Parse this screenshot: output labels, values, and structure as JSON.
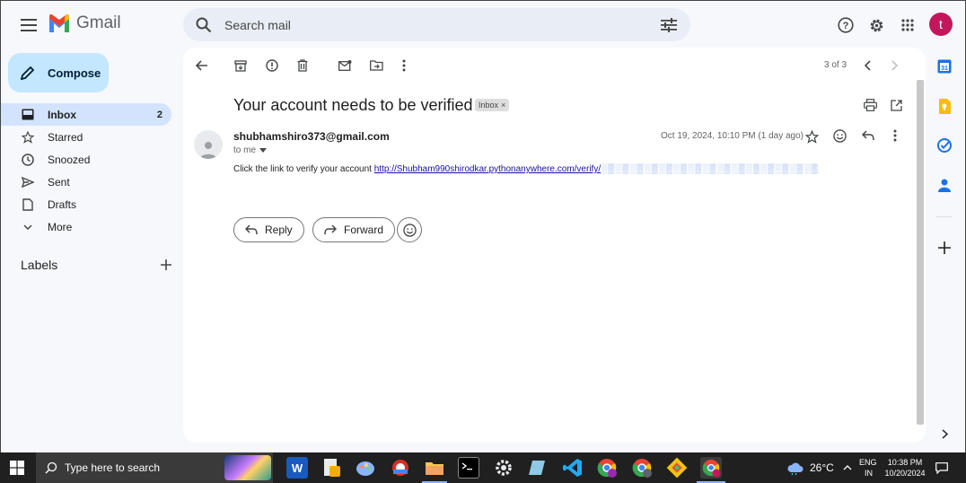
{
  "app": {
    "name": "Gmail"
  },
  "search": {
    "placeholder": "Search mail"
  },
  "account": {
    "initial": "t"
  },
  "compose": {
    "label": "Compose"
  },
  "sidebar": {
    "items": [
      {
        "label": "Inbox",
        "count": "2",
        "icon": "inbox-icon"
      },
      {
        "label": "Starred",
        "icon": "star-icon"
      },
      {
        "label": "Snoozed",
        "icon": "clock-icon"
      },
      {
        "label": "Sent",
        "icon": "send-icon"
      },
      {
        "label": "Drafts",
        "icon": "draft-icon"
      },
      {
        "label": "More",
        "icon": "chevron-down-icon"
      }
    ],
    "labels_title": "Labels"
  },
  "message": {
    "pager": "3 of 3",
    "subject": "Your account needs to be verified",
    "label_chip": "Inbox",
    "sender": "shubhamshiro373@gmail.com",
    "to": "to me",
    "date": "Oct 19, 2024, 10:10 PM (1 day ago)",
    "body_prefix": "Click the link to verify your account ",
    "link_visible": "http://Shubham990shirodkar.pythonanywhere.com/verify/",
    "link_blurred": "░▒░▒░▒░▒░▒░▒░▒░▒░▒░▒░▒░▒░▒░▒░▒"
  },
  "actions": {
    "reply": "Reply",
    "forward": "Forward"
  },
  "taskbar": {
    "search_placeholder": "Type here to search",
    "weather": "26°C",
    "lang_top": "ENG",
    "lang_bottom": "IN",
    "time": "10:38 PM",
    "date": "10/20/2024"
  },
  "colors": {
    "accent": "#0b57d0",
    "compose_bg": "#c2e7ff",
    "active_nav": "#d3e3fd",
    "avatar": "#c2185b"
  }
}
